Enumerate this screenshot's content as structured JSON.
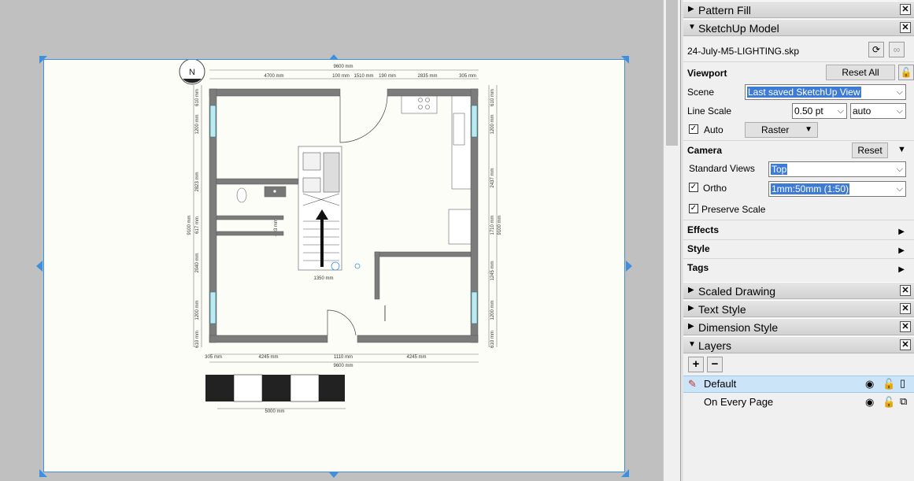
{
  "plan": {
    "north": "N",
    "dims": {
      "top_total": "9600 mm",
      "top_parts": [
        "4700 mm",
        "100 mm",
        "1510 mm",
        "190 mm",
        "2835 mm",
        "305 mm"
      ],
      "bottom_parts": [
        "305 mm",
        "4245 mm",
        "1110 mm",
        "4245 mm"
      ],
      "bottom_total": "9600 mm",
      "left_parts": [
        "610 mm",
        "1200 mm",
        "2823 mm",
        "617 mm",
        "2040 mm",
        "1200 mm",
        "610 mm"
      ],
      "left_total": "9100 mm",
      "right_parts": [
        "610 mm",
        "1200 mm",
        "2437 mm",
        "1710 mm",
        "1245 mm",
        "1200 mm",
        "610 mm"
      ],
      "right_total": "9100 mm",
      "stair": "1350 mm",
      "bath": "403 mm"
    },
    "scale_bar": "5000 mm"
  },
  "panel": {
    "pattern_fill": "Pattern Fill",
    "sketchup_model": "SketchUp Model",
    "file_name": "24-July-M5-LIGHTING.skp",
    "viewport": {
      "title": "Viewport",
      "reset_all": "Reset All",
      "scene_label": "Scene",
      "scene_value": "Last saved SketchUp View",
      "line_scale_label": "Line Scale",
      "line_scale_value": "0.50 pt",
      "line_scale_mode": "auto",
      "auto_label": "Auto",
      "render_mode": "Raster"
    },
    "camera": {
      "title": "Camera",
      "reset": "Reset",
      "standard_views_label": "Standard Views",
      "standard_views_value": "Top",
      "ortho_label": "Ortho",
      "ortho_value": "1mm:50mm (1:50)",
      "preserve_scale_label": "Preserve Scale"
    },
    "sections": {
      "effects": "Effects",
      "style": "Style",
      "tags": "Tags"
    },
    "trays": {
      "scaled_drawing": "Scaled Drawing",
      "text_style": "Text Style",
      "dimension_style": "Dimension Style",
      "layers": "Layers"
    },
    "layers": {
      "default": "Default",
      "on_every_page": "On Every Page"
    }
  }
}
